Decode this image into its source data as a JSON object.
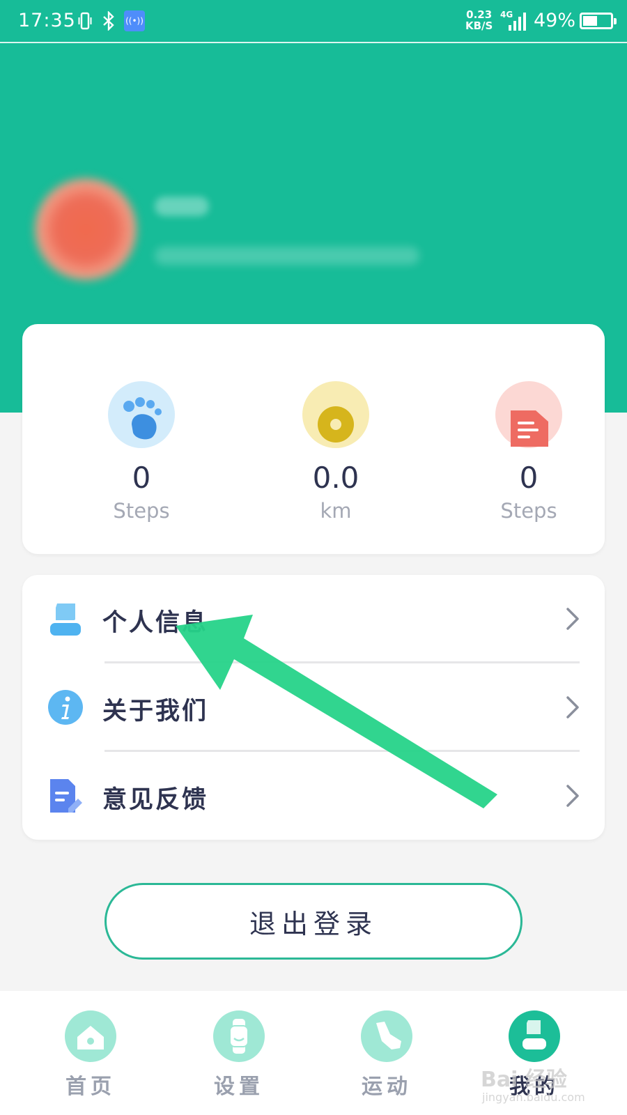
{
  "status_bar": {
    "time": "17:35",
    "net_speed": "0.23",
    "net_speed_unit": "KB/S",
    "network_type": "4G",
    "battery_percent": "49%",
    "icons": [
      "vibrate-icon",
      "bluetooth-icon",
      "hotspot-icon",
      "signal-icon",
      "battery-icon"
    ]
  },
  "profile": {
    "avatar": "blurred-avatar",
    "name": "",
    "id_line": ""
  },
  "stats": [
    {
      "icon": "paw-icon",
      "value": "0",
      "unit": "Steps",
      "color": "#d3ecfb"
    },
    {
      "icon": "distance-icon",
      "value": "0.0",
      "unit": "km",
      "color": "#f8ecb3"
    },
    {
      "icon": "report-icon",
      "value": "0",
      "unit": "Steps",
      "color": "#fcd8d4"
    }
  ],
  "menu": [
    {
      "icon": "user-icon",
      "label": "个人信息"
    },
    {
      "icon": "info-icon",
      "label": "关于我们"
    },
    {
      "icon": "feedback-icon",
      "label": "意见反馈"
    }
  ],
  "logout_label": "退出登录",
  "tabs": [
    {
      "icon": "home-icon",
      "label": "首页",
      "active": false
    },
    {
      "icon": "watch-icon",
      "label": "设置",
      "active": false
    },
    {
      "icon": "shoe-icon",
      "label": "运动",
      "active": false
    },
    {
      "icon": "profile-icon",
      "label": "我的",
      "active": true
    }
  ],
  "colors": {
    "primary": "#17bc98",
    "arrow": "#26d389",
    "text_dark": "#2e3350",
    "text_muted": "#a4a8b4"
  },
  "watermark": {
    "text": "Bai 经验",
    "sub": "jingyan.baidu.com"
  }
}
